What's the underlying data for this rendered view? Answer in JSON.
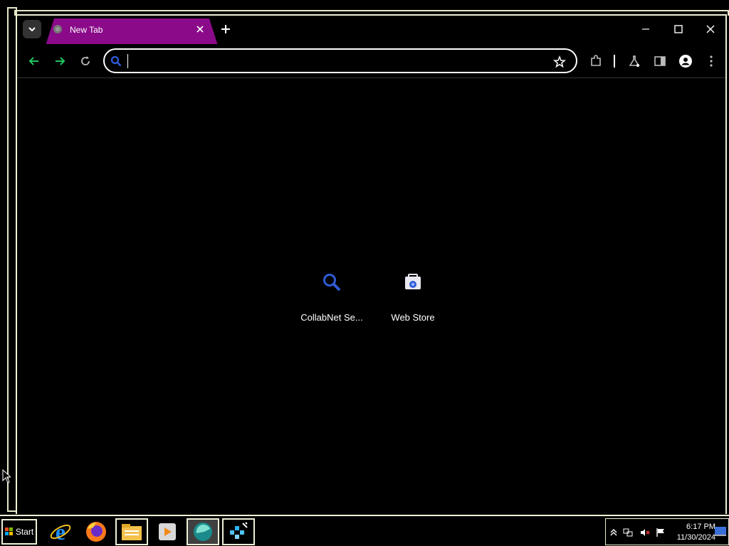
{
  "browser": {
    "tab": {
      "title": "New Tab",
      "favicon": "globe-icon",
      "close_icon": "close-icon"
    },
    "new_tab_icon": "plus-icon",
    "window_controls": [
      "minimize-icon",
      "maximize-icon",
      "close-icon"
    ],
    "toolbar": {
      "back_icon": "arrow-left-icon",
      "forward_icon": "arrow-right-icon",
      "reload_icon": "reload-icon",
      "omnibox": {
        "value": "",
        "placeholder": "",
        "icon": "search-icon"
      },
      "bookmark_icon": "star-icon",
      "extensions_icon": "puzzle-icon",
      "labs_icon": "flask-icon",
      "side_panel_icon": "side-panel-icon",
      "profile_icon": "profile-icon",
      "menu_icon": "kebab-menu-icon"
    },
    "shortcuts": [
      {
        "label": "CollabNet Se...",
        "icon": "search-icon"
      },
      {
        "label": "Web Store",
        "icon": "web-store-icon"
      }
    ]
  },
  "taskbar": {
    "start_label": "Start",
    "items": [
      "internet-explorer-icon",
      "firefox-icon",
      "file-explorer-icon",
      "media-player-icon",
      "browser-app-icon",
      "network-app-icon"
    ],
    "tray_icons": [
      "chevron-up-icon",
      "network-icon",
      "volume-muted-icon",
      "flag-icon"
    ],
    "clock": {
      "time": "6:17 PM",
      "date": "11/30/2024"
    }
  },
  "colors": {
    "tab_active": "#8a0a8a",
    "accent_green": "#22c55e",
    "accent_blue": "#2f5bd6"
  }
}
